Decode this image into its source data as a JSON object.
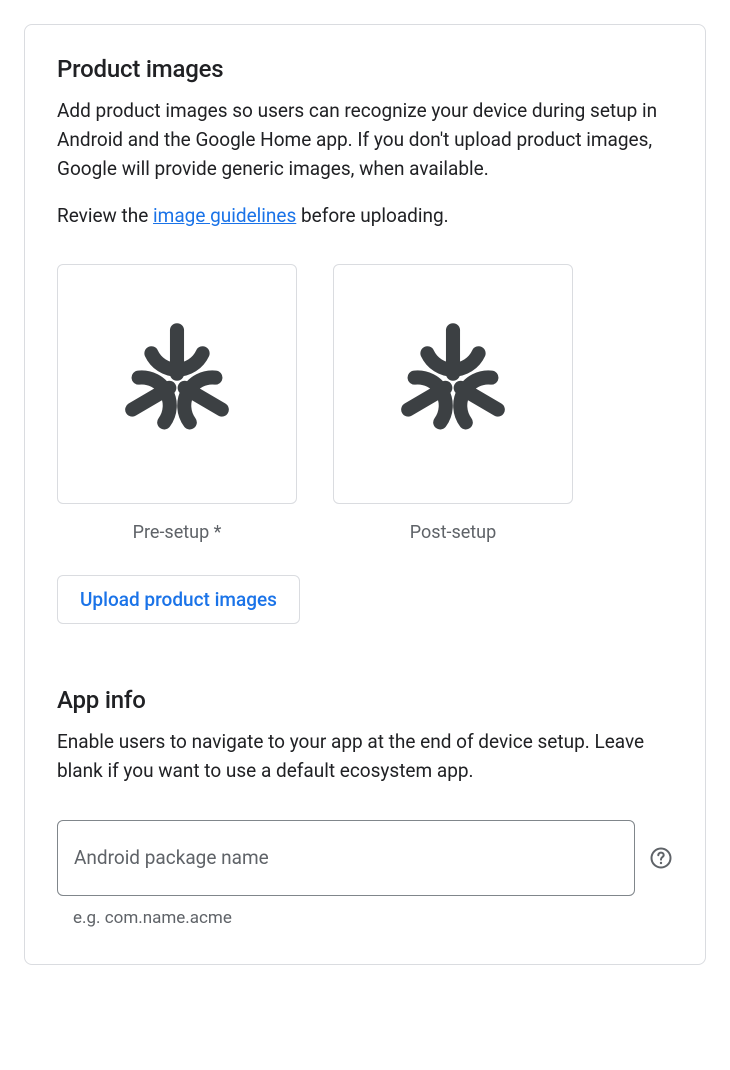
{
  "productImages": {
    "title": "Product images",
    "description": "Add product images so users can recognize your device during setup in Android and the Google Home app. If you don't upload product images, Google will provide generic images, when available.",
    "review_prefix": "Review the ",
    "review_link": "image guidelines",
    "review_suffix": " before uploading.",
    "slots": [
      {
        "caption": "Pre-setup *"
      },
      {
        "caption": "Post-setup"
      }
    ],
    "uploadLabel": "Upload product images"
  },
  "appInfo": {
    "title": "App info",
    "description": "Enable users to navigate to your app at the end of device setup. Leave blank if you want to use a default ecosystem app.",
    "packageField": {
      "placeholder": "Android package name",
      "value": "",
      "hint": "e.g. com.name.acme"
    }
  }
}
